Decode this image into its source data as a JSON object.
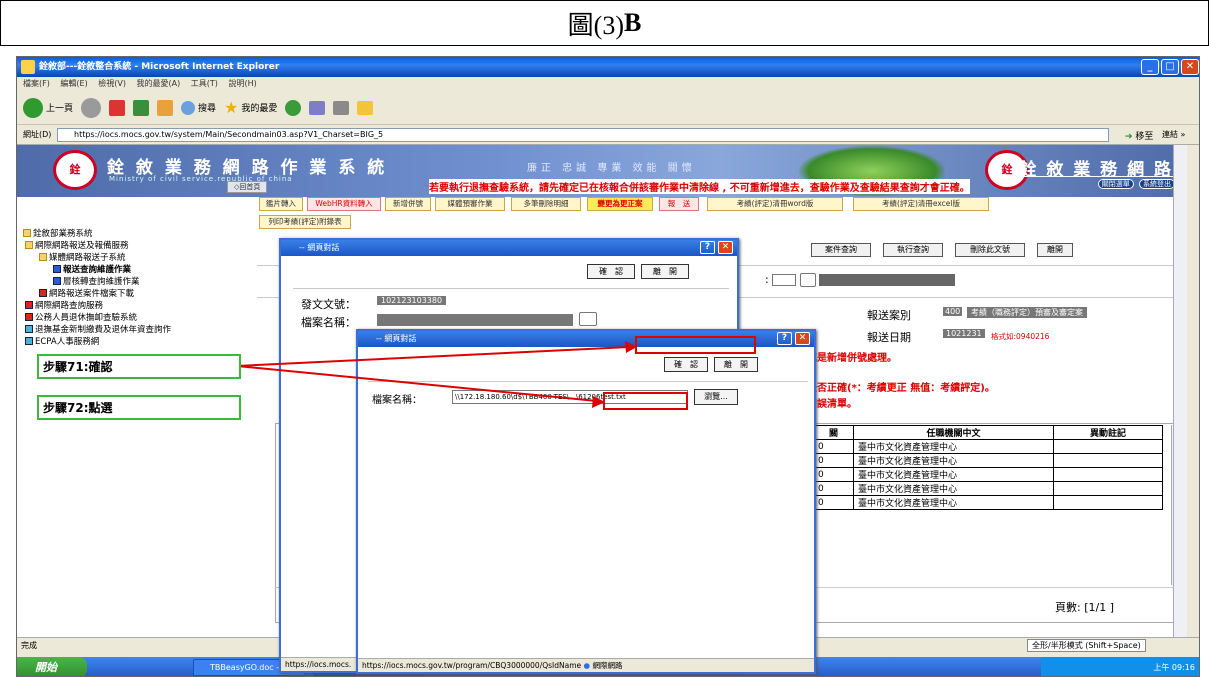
{
  "header": {
    "fig": "圖(3)",
    "letter": "B"
  },
  "ie": {
    "title": "銓敘部---銓敘整合系統 - Microsoft Internet Explorer",
    "menu": [
      "檔案(F)",
      "編輯(E)",
      "檢視(V)",
      "我的最愛(A)",
      "工具(T)",
      "說明(H)"
    ],
    "toolbar": {
      "back": "上一頁",
      "search": "搜尋",
      "favorites": "我的最愛"
    },
    "address_label": "網址(D)",
    "address": "https://iocs.mocs.gov.tw/system/Main/Secondmain03.asp?V1_Charset=BIG_5",
    "go": "移至",
    "links": "連結 »",
    "status": "完成"
  },
  "banner": {
    "title": "銓 敘 業 務 網 路 作 業 系 統",
    "subtitle": "Ministry of civil service.republic of china",
    "slogan": "廉正 忠誠 專業 效能 關懷",
    "right_title": "銓 敘 業 務 網 路",
    "close_menu": "關閉選單",
    "logout": "系統登出",
    "emblem": "銓",
    "home": "◇回首頁",
    "notice": "若要執行退撫查驗系統，請先確定已在核報合併該審作業中清除線 , 不可重新增進去，查驗作業及查驗結果查詢才會正確。"
  },
  "nav": {
    "root": "銓敘部業務系統",
    "items": [
      "網際網路報送及報備服務",
      "媒體網路報送子系統",
      "報送查詢維護作業",
      "層核轉查詢維護作業",
      "網路報送案件檔案下載",
      "網際網路查詢服務",
      "公務人員退休撫卹查驗系統",
      "退撫基金新制繳費及退休年資查詢作",
      "ECPA人事服務網"
    ]
  },
  "buttons": {
    "row1": [
      "鑑片轉入",
      "WebHR資料轉入",
      "新增併號",
      "媒體預審作業",
      "多筆刪除明細",
      "變更為更正案",
      "報　送",
      "考績(評定)清冊word版",
      "考績(評定)清冊excel版"
    ],
    "row2": [
      "列印考績(評定)附錄表"
    ],
    "row3": [
      "案件查詢",
      "執行查詢",
      "刪除此文號",
      "離開"
    ]
  },
  "form": {
    "case_type_label": "報送案別",
    "case_type_code": "400",
    "case_type_value": "考績（職務評定）預審及審定案",
    "date_label": "報送日期",
    "date_value": "1021231",
    "date_hint": "格式如:0940216",
    "red1": "新增資料或是新增併號處理。",
    "red2": "正註記，是否正確(*：考績更正 無值：考績評定)。",
    "red3": "提供檢核錯誤清單。",
    "page_info": "頁數: [1/1 ]",
    "side_labels": [
      "C",
      "身",
      "報",
      "報",
      "注"
    ],
    "pager": "[ ◄ ] [ ◄ ]"
  },
  "table": {
    "headers": [
      "關",
      "任職機關中文",
      "異動註記"
    ],
    "rows": [
      [
        "0",
        "臺中市文化資產管理中心",
        ""
      ],
      [
        "0",
        "臺中市文化資產管理中心",
        ""
      ],
      [
        "0",
        "臺中市文化資產管理中心",
        ""
      ],
      [
        "0",
        "臺中市文化資產管理中心",
        ""
      ],
      [
        "0",
        "臺中市文化資產管理中心",
        ""
      ]
    ]
  },
  "dialog1": {
    "title": "-- 網頁對話",
    "confirm": "確　認",
    "leave": "離　開",
    "doc_no_label": "發文文號：",
    "doc_no": "102123103380",
    "file_label": "檔案名稱：",
    "status": "https://iocs.mocs."
  },
  "dialog2": {
    "title": "-- 網頁對話",
    "confirm": "確　認",
    "leave": "離　開",
    "file_label": "檔案名稱：",
    "file_path": "\\\\172.18.180.60\\d$\\TBB400-TES\\...\\61206test.txt",
    "browse": "瀏覽...",
    "status": "https://iocs.mocs.gov.tw/program/CBQ3000000/QsIdName",
    "zone": "網際網路"
  },
  "callouts": {
    "step71": "步驟71:確認",
    "step72": "步驟72:點選"
  },
  "taskbar": {
    "start": "開始",
    "tasks": [
      "TBBeasyGO.doc - Mic...",
      "銓敘部---銓敘整合..."
    ],
    "ime": "全形/半形模式 (Shift+Space)",
    "clock": "上午 09:16"
  }
}
